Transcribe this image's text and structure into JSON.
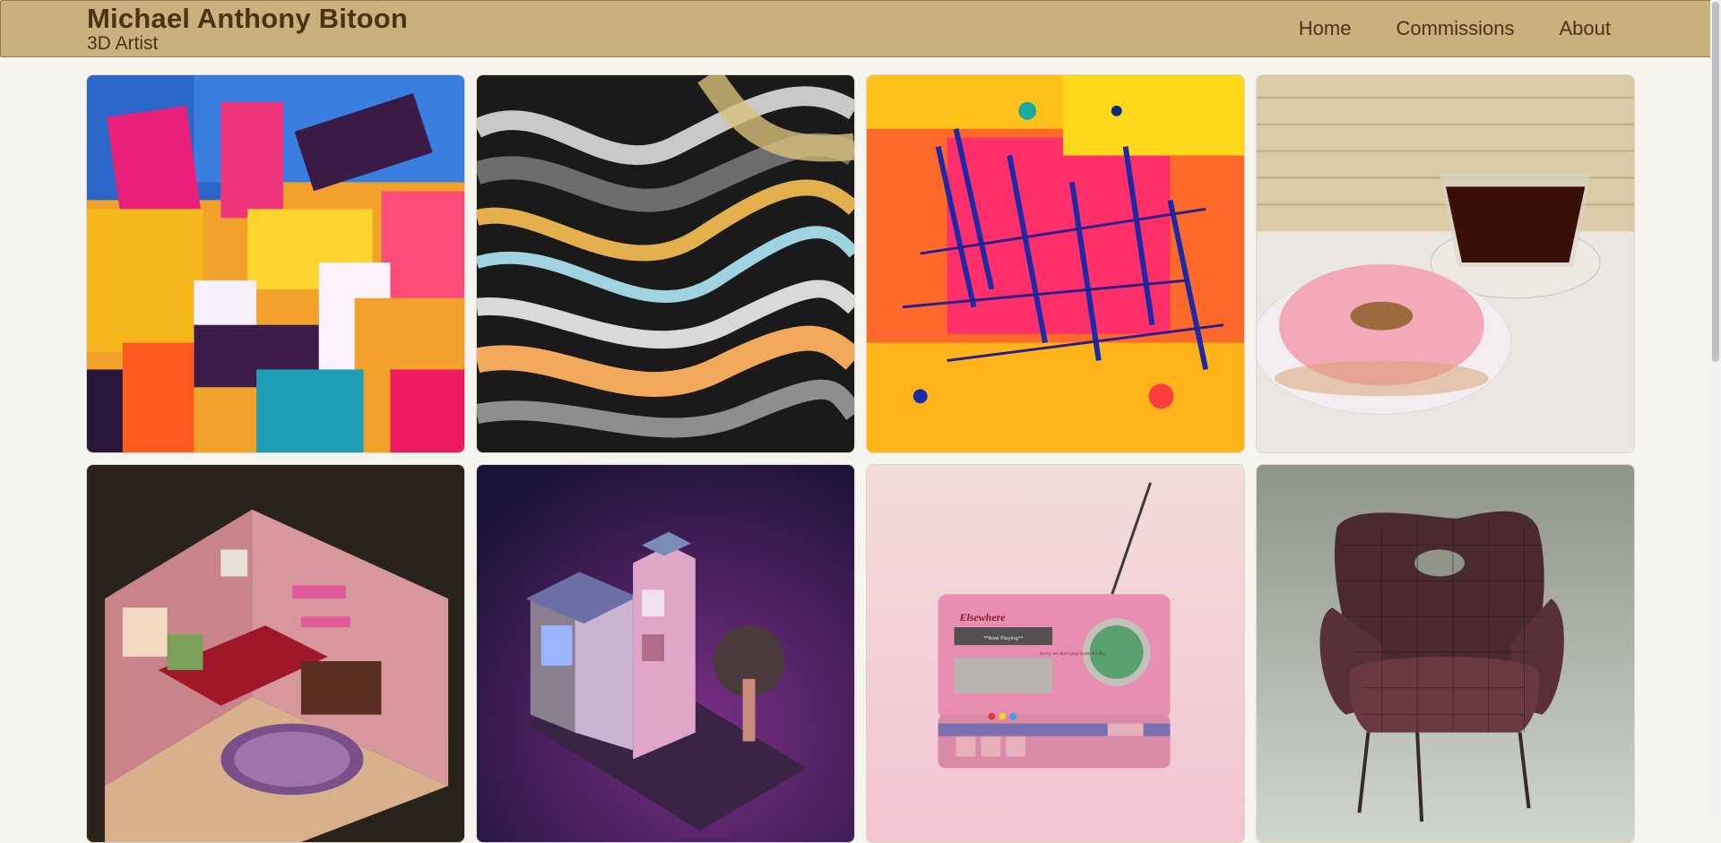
{
  "header": {
    "name": "Michael Anthony Bitoon",
    "subtitle": "3D Artist"
  },
  "nav": [
    {
      "label": "Home"
    },
    {
      "label": "Commissions"
    },
    {
      "label": "About"
    }
  ],
  "gallery": [
    {
      "kind": "abstract-painting-blocks"
    },
    {
      "kind": "fluid-marble-art"
    },
    {
      "kind": "abstract-splatter-painting"
    },
    {
      "kind": "donut-and-coffee-render"
    },
    {
      "kind": "isometric-bedroom-render"
    },
    {
      "kind": "isometric-house-render"
    },
    {
      "kind": "retro-radio-render",
      "text": {
        "brand": "Elsewhere",
        "display": "**Now Playing**",
        "tagline": "Sorry, we don't play Lone del Rey"
      }
    },
    {
      "kind": "armchair-wireframe-render"
    }
  ],
  "colors": {
    "header_bg": "#c9b17e",
    "header_text": "#4b3416",
    "page_bg": "#f6f4ee"
  }
}
